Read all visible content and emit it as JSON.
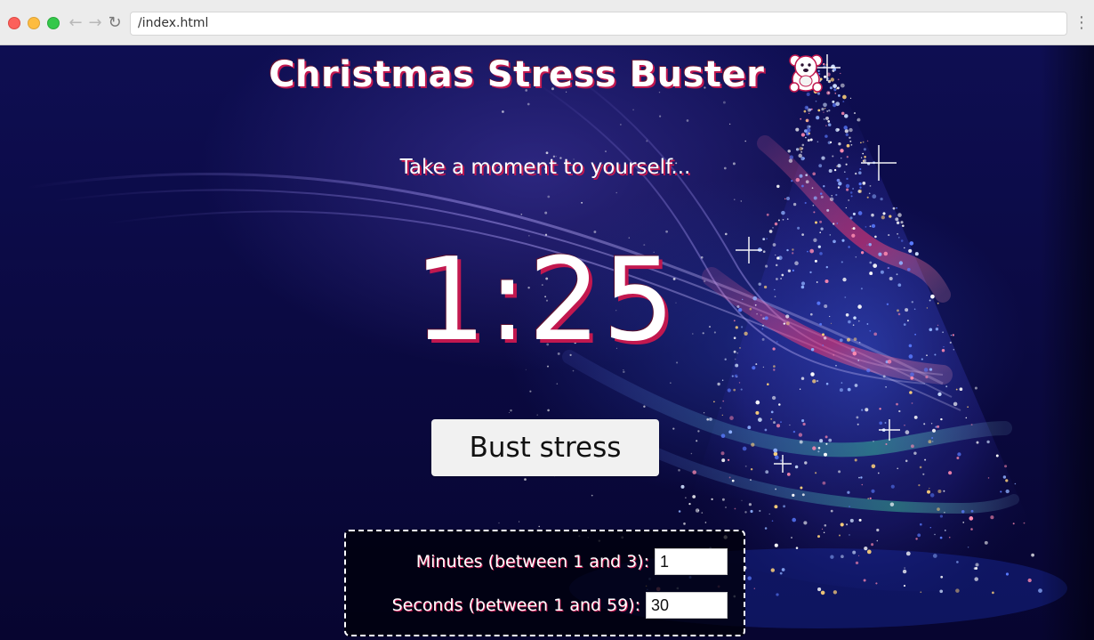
{
  "browser": {
    "url": "/index.html",
    "icons": {
      "back": "arrow-left-icon",
      "forward": "arrow-right-icon",
      "reload": "reload-icon",
      "menu": "vertical-dots-icon"
    }
  },
  "page": {
    "title": "Christmas Stress Buster",
    "title_icon": "teddy-bear-icon",
    "tagline": "Take a moment to yourself...",
    "timer": "1:25",
    "bust_button_label": "Bust stress",
    "settings": {
      "minutes_label": "Minutes (between 1 and 3):",
      "minutes_value": "1",
      "seconds_label": "Seconds (between 1 and 59):",
      "seconds_value": "30"
    }
  },
  "colors": {
    "background": "#0b0a43",
    "text": "#ffffff",
    "text_shadow": "#c2184f",
    "button": "#f1f1f1"
  }
}
